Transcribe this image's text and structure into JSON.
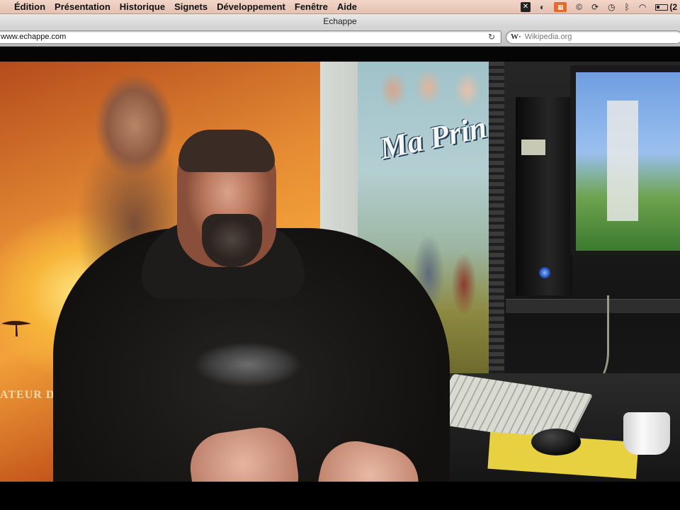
{
  "menubar": {
    "items": [
      "Édition",
      "Présentation",
      "Historique",
      "Signets",
      "Développement",
      "Fenêtre",
      "Aide"
    ],
    "battery_text": "(2"
  },
  "window": {
    "title": "Echappe"
  },
  "toolbar": {
    "url": "www.echappe.com",
    "search_placeholder": "Wikipedia.org",
    "search_prefix": "W·"
  },
  "video": {
    "poster_left_text": "ATEUR D",
    "poster_right_text": "Ma Prin"
  }
}
